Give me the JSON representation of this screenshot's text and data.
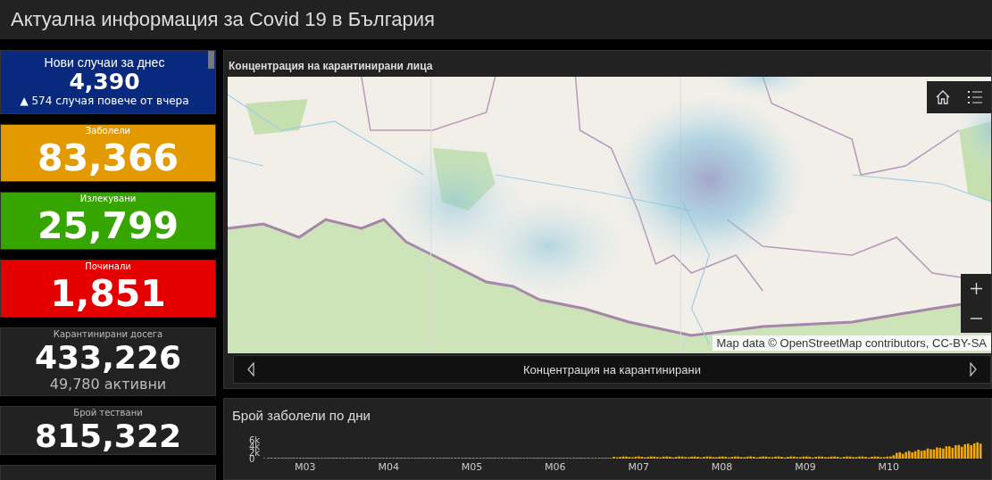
{
  "header": {
    "title": "Актуална информация за Covid 19 в България"
  },
  "indicators": [
    {
      "kind": "trend",
      "color": "#08297e",
      "label": "Нови случаи за днес",
      "value": "4,390",
      "sub": "▲ 574 случая повече от вчера"
    },
    {
      "kind": "plain",
      "color": "#e39a00",
      "label": "Заболели",
      "value": "83,366"
    },
    {
      "kind": "plain",
      "color": "#36a500",
      "label": "Излекувани",
      "value": "25,799"
    },
    {
      "kind": "plain",
      "color": "#e50000",
      "label": "Починали",
      "value": "1,851"
    },
    {
      "kind": "dark",
      "color": "#222222",
      "label": "Карантинирани досега",
      "value": "433,226",
      "sub": "49,780 активни"
    },
    {
      "kind": "dark",
      "color": "#222222",
      "label": "Брой тествани",
      "value": "815,322"
    }
  ],
  "map_panel": {
    "title": "Концентрация на карантинирани лица",
    "attribution": "Map data © OpenStreetMap contributors, CC-BY-SA",
    "pager": {
      "label": "Концентрация на карантинирани"
    }
  },
  "chart_panel": {
    "title": "Брой заболели по дни",
    "y_axis_labels": [
      "6k",
      "4k",
      "2k",
      "0"
    ],
    "x_axis_labels": [
      "M03",
      "M04",
      "M05",
      "M06",
      "M07",
      "M08",
      "M09",
      "M10"
    ]
  }
}
